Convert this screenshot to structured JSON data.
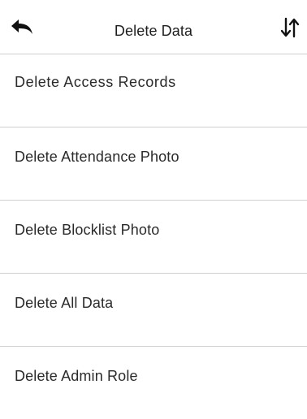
{
  "header": {
    "title": "Delete Data",
    "back_icon": "back-arrow-icon",
    "sort_icon": "sort-arrows-icon"
  },
  "menu": {
    "items": [
      {
        "label": "Delete Access Records"
      },
      {
        "label": "Delete Attendance Photo"
      },
      {
        "label": "Delete Blocklist Photo"
      },
      {
        "label": "Delete All Data"
      },
      {
        "label": "Delete Admin Role"
      }
    ]
  },
  "colors": {
    "background": "#ffffff",
    "text": "#222222",
    "divider": "#cfcfcf",
    "icon": "#111111"
  }
}
